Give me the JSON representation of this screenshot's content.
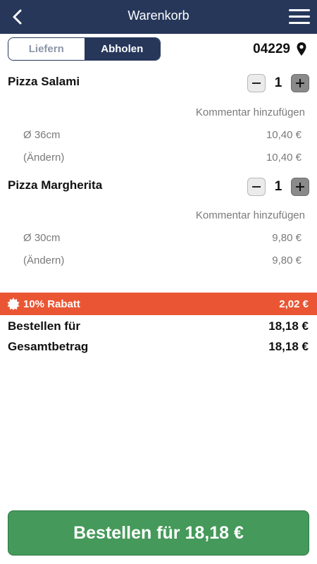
{
  "header": {
    "title": "Warenkorb",
    "back_icon": "chevron-left-icon",
    "menu_icon": "hamburger-menu-icon",
    "bar_color": "#26375a"
  },
  "delivery_toggle": {
    "options": [
      "Liefern",
      "Abholen"
    ],
    "selected": "Abholen"
  },
  "location": {
    "zip": "04229",
    "icon": "location-pin-icon"
  },
  "cart": {
    "items": [
      {
        "name": "Pizza Salami",
        "quantity": "1",
        "comment_label": "Kommentar hinzufügen",
        "size": "Ø 36cm",
        "size_price": "10,40 €",
        "change_label": "(Ändern)",
        "change_price": "10,40 €"
      },
      {
        "name": "Pizza Margherita",
        "quantity": "1",
        "comment_label": "Kommentar hinzufügen",
        "size": "Ø 30cm",
        "size_price": "9,80 €",
        "change_label": "(Ändern)",
        "change_price": "9,80 €"
      }
    ]
  },
  "discount": {
    "label": "10% Rabatt",
    "value": "2,02 €",
    "icon": "discount-badge-icon",
    "color": "#ea5633"
  },
  "summary": {
    "order_for_label": "Bestellen für",
    "order_for_value": "18,18 €",
    "total_label": "Gesamtbetrag",
    "total_value": "18,18 €"
  },
  "order_button": {
    "label": "Bestellen für 18,18 €",
    "color": "#45995a"
  }
}
